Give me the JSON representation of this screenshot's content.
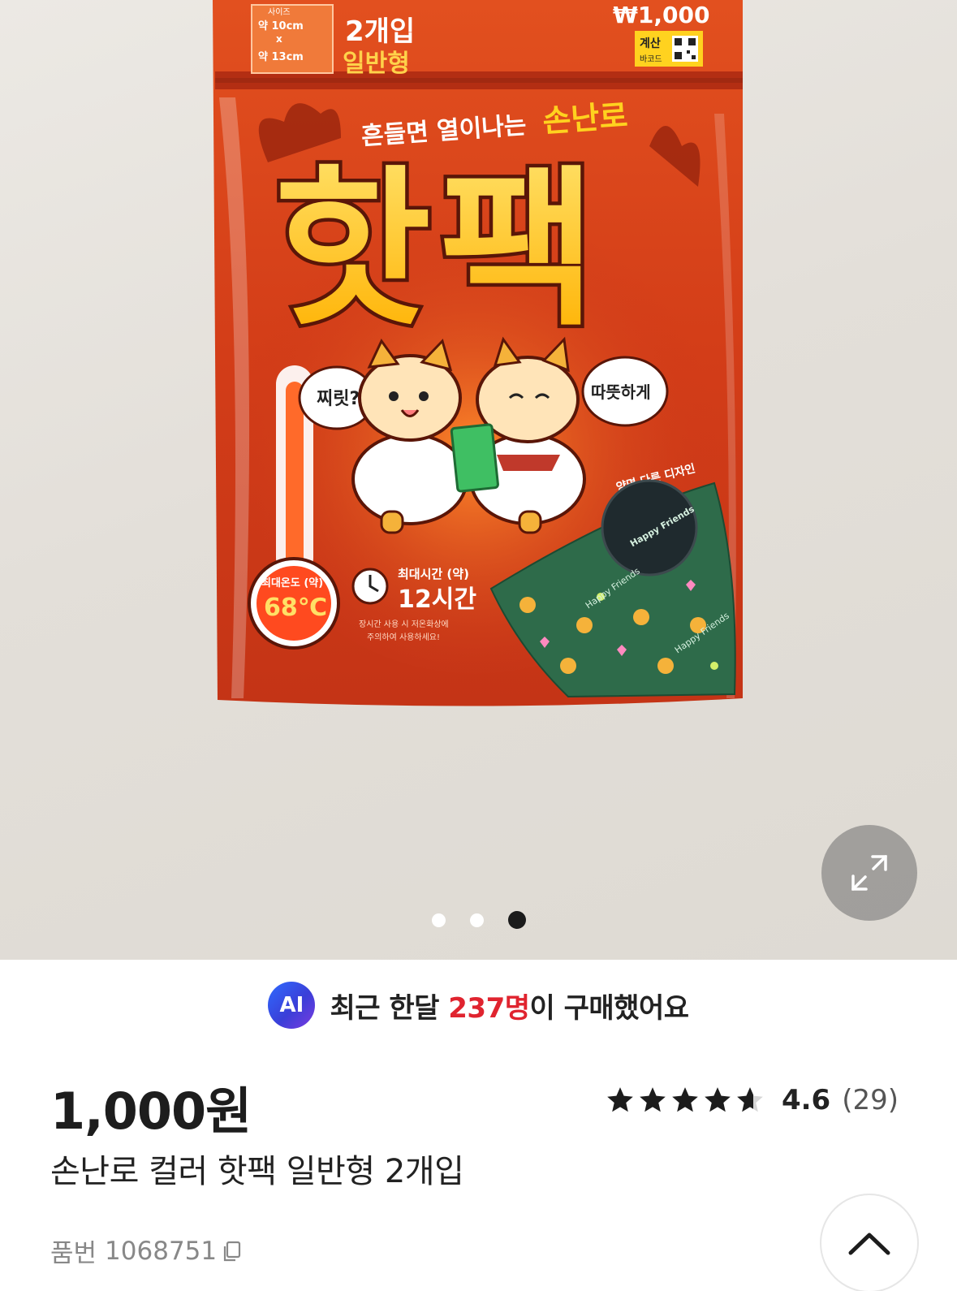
{
  "gallery": {
    "package": {
      "size_label": "사이즈",
      "size_width": "약 10cm",
      "size_x": "x",
      "size_height": "약 13cm",
      "count": "2개입",
      "type": "일반형",
      "pack_price": "₩1,000",
      "barcode_label_top": "계산",
      "barcode_label_bottom": "바코드",
      "tagline_prefix": "흔들면 열이나는",
      "tagline_brand": "손난로",
      "title": "핫팩",
      "bubble_left": "찌릿?",
      "bubble_right": "따뜻하게",
      "max_temp_label": "최대온도 (약)",
      "max_temp_value": "68℃",
      "max_time_label": "최대시간 (약)",
      "max_time_value": "12시간",
      "warning_line1": "장시간 사용 시 저온화상에",
      "warning_line2": "주의하여 사용하세요!",
      "design_note": "양면 다른 디자인",
      "pattern_text": "Happy Friends"
    },
    "expand_icon": "expand-arrows-icon",
    "pager": {
      "count": 3,
      "active_index": 2
    }
  },
  "ai_banner": {
    "badge": "AI",
    "prefix": "최근 한달 ",
    "count": "237명",
    "suffix": "이 구매했어요"
  },
  "product": {
    "price": "1,000원",
    "rating": {
      "stars": 4.6,
      "score": "4.6",
      "count": "(29)"
    },
    "name": "손난로 컬러 핫팩 일반형 2개입",
    "sku_label": "품번",
    "sku": "1068751"
  },
  "colors": {
    "accent_red": "#e0242f",
    "package_red": "#d63b1c",
    "title_yellow": "#ffc21a",
    "pattern_green": "#2e6b4a"
  }
}
